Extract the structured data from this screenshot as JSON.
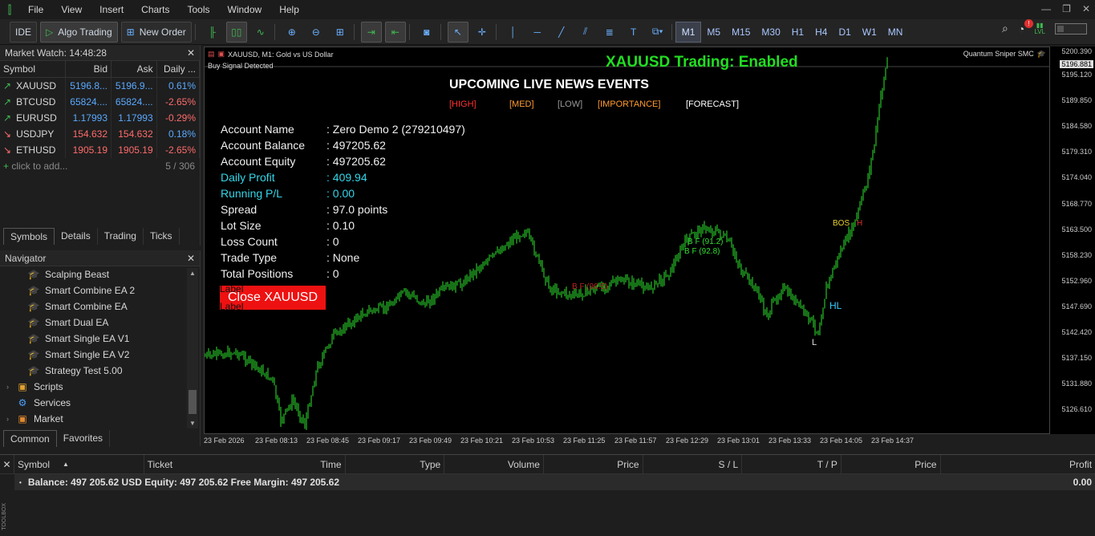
{
  "menu": {
    "items": [
      "File",
      "View",
      "Insert",
      "Charts",
      "Tools",
      "Window",
      "Help"
    ]
  },
  "toolbar": {
    "ide": "IDE",
    "algo": "Algo Trading",
    "new_order": "New Order",
    "timeframes": [
      "M1",
      "M5",
      "M15",
      "M30",
      "H1",
      "H4",
      "D1",
      "W1",
      "MN"
    ],
    "active_tf": "M1",
    "lvl": "LVL"
  },
  "market_watch": {
    "title": "Market Watch: 14:48:28",
    "cols": [
      "Symbol",
      "Bid",
      "Ask",
      "Daily ..."
    ],
    "rows": [
      {
        "sym": "XAUUSD",
        "bid": "5196.8...",
        "ask": "5196.9...",
        "chg": "0.61%",
        "dir": "up"
      },
      {
        "sym": "BTCUSD",
        "bid": "65824....",
        "ask": "65824....",
        "chg": "-2.65%",
        "dir": "up"
      },
      {
        "sym": "EURUSD",
        "bid": "1.17993",
        "ask": "1.17993",
        "chg": "-0.29%",
        "dir": "up"
      },
      {
        "sym": "USDJPY",
        "bid": "154.632",
        "ask": "154.632",
        "chg": "0.18%",
        "dir": "down"
      },
      {
        "sym": "ETHUSD",
        "bid": "1905.19",
        "ask": "1905.19",
        "chg": "-2.65%",
        "dir": "down"
      }
    ],
    "add": "click to add...",
    "count": "5 / 306",
    "tabs": [
      "Symbols",
      "Details",
      "Trading",
      "Ticks"
    ]
  },
  "navigator": {
    "title": "Navigator",
    "items": [
      {
        "label": "Scalping Beast",
        "type": "ea"
      },
      {
        "label": "Smart Combine EA 2",
        "type": "ea"
      },
      {
        "label": "Smart Combine EA",
        "type": "ea"
      },
      {
        "label": "Smart Dual EA",
        "type": "ea"
      },
      {
        "label": "Smart Single EA V1",
        "type": "ea"
      },
      {
        "label": "Smart Single EA V2",
        "type": "ea"
      },
      {
        "label": "Strategy Test 5.00",
        "type": "ea"
      },
      {
        "label": "Scripts",
        "type": "folder"
      },
      {
        "label": "Services",
        "type": "gear"
      },
      {
        "label": "Market",
        "type": "bag"
      }
    ],
    "tabs": [
      "Common",
      "Favorites"
    ]
  },
  "chart": {
    "header": "XAUUSD, M1:  Gold vs US Dollar",
    "signal": "Buy Signal Detected",
    "trading": "XAUUSD Trading: Enabled",
    "brand": "Quantum Sniper SMC",
    "news_title": "UPCOMING LIVE NEWS EVENTS",
    "news_legend": [
      "[HIGH]",
      "[MED]",
      "[LOW]",
      "[IMPORTANCE]",
      "[FORECAST]"
    ],
    "account": [
      {
        "k": "Account Name",
        "v": ": Zero Demo 2 (279210497)",
        "c": "#f0f0f0"
      },
      {
        "k": "Account Balance",
        "v": ": 497205.62",
        "c": "#f0f0f0"
      },
      {
        "k": "Account Equity",
        "v": ": 497205.62",
        "c": "#f0f0f0"
      },
      {
        "k": "Daily Profit",
        "v": ": 409.94",
        "c": "#33d6e8"
      },
      {
        "k": "Running P/L",
        "v": ": 0.00",
        "c": "#33d6e8"
      },
      {
        "k": "Spread",
        "v": ": 97.0 points",
        "c": "#f0f0f0"
      },
      {
        "k": "Lot Size",
        "v": ": 0.10",
        "c": "#f0f0f0"
      },
      {
        "k": "Loss Count",
        "v": ": 0",
        "c": "#f0f0f0"
      },
      {
        "k": "Trade Type",
        "v": ": None",
        "c": "#f0f0f0"
      },
      {
        "k": "Total Positions",
        "v": ": 0",
        "c": "#f0f0f0"
      }
    ],
    "close_btn": "Close XAUUSD",
    "label1": "Label",
    "label2": "Label",
    "annotations": {
      "bos": "BOS",
      "h": "H",
      "bf1": "B F (91.2)",
      "bf2": "B F (92.8)",
      "hl": "HL",
      "l": "L",
      "bf3": "B F (90.5)"
    },
    "price_current": "5196.881",
    "prices": [
      "5200.390",
      "5195.120",
      "5189.850",
      "5184.580",
      "5179.310",
      "5174.040",
      "5168.770",
      "5163.500",
      "5158.230",
      "5152.960",
      "5147.690",
      "5142.420",
      "5137.150",
      "5131.880",
      "5126.610"
    ],
    "times": [
      "23 Feb 2026",
      "23 Feb 08:13",
      "23 Feb 08:45",
      "23 Feb 09:17",
      "23 Feb 09:49",
      "23 Feb 10:21",
      "23 Feb 10:53",
      "23 Feb 11:25",
      "23 Feb 11:57",
      "23 Feb 12:29",
      "23 Feb 13:01",
      "23 Feb 13:33",
      "23 Feb 14:05",
      "23 Feb 14:37"
    ]
  },
  "terminal": {
    "cols": [
      "Symbol",
      "Ticket",
      "Time",
      "Type",
      "Volume",
      "Price",
      "S / L",
      "T / P",
      "Price",
      "Profit"
    ],
    "balance": "Balance: 497 205.62 USD  Equity: 497 205.62  Free Margin: 497 205.62",
    "profit": "0.00",
    "side": "TOOLBOX"
  }
}
